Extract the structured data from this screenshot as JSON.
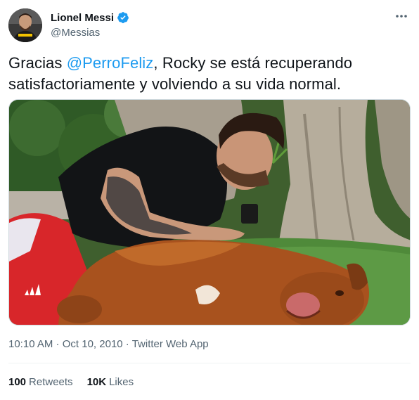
{
  "author": {
    "display_name": "Lionel Messi",
    "handle": "@Messias",
    "verified_icon": "verified-badge-icon"
  },
  "tweet": {
    "text_before": "Gracias ",
    "mention": "@PerroFeliz",
    "text_after": ", Rocky se está recuperando satisfactoriamente y volviendo a su vida normal."
  },
  "meta": {
    "time": "10:10 AM",
    "separator": " · ",
    "date": "Oct 10, 2010",
    "source": "Twitter Web App"
  },
  "stats": {
    "retweets_count": "100",
    "retweets_label": "Retweets",
    "likes_count": "10K",
    "likes_label": "Likes"
  },
  "colors": {
    "accent": "#1d9bf0",
    "text": "#0f1419",
    "secondary": "#536471"
  }
}
